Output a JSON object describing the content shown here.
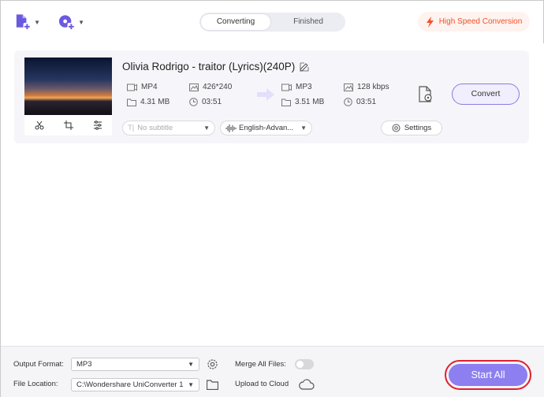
{
  "toolbar": {
    "add_file_icon": "add-file-icon",
    "add_dvd_icon": "add-dvd-icon",
    "tabs": [
      {
        "label": "Converting",
        "active": true
      },
      {
        "label": "Finished",
        "active": false
      }
    ],
    "high_speed_label": "High Speed Conversion",
    "accent": "#f0522a"
  },
  "file": {
    "title": "Olivia Rodrigo - traitor (Lyrics)(240P)",
    "source": {
      "format": "MP4",
      "resolution": "426*240",
      "size": "4.31 MB",
      "duration": "03:51"
    },
    "target": {
      "format": "MP3",
      "bitrate": "128 kbps",
      "size": "3.51 MB",
      "duration": "03:51"
    },
    "convert_label": "Convert",
    "subtitle_value": "No subtitle",
    "audio_value": "English-Advan...",
    "settings_label": "Settings"
  },
  "bottom": {
    "output_format_label": "Output Format:",
    "output_format_value": "MP3",
    "merge_label": "Merge All Files:",
    "merge_on": false,
    "file_location_label": "File Location:",
    "file_location_value": "C:\\Wondershare UniConverter 1",
    "upload_label": "Upload to Cloud",
    "start_all_label": "Start All",
    "start_color": "#8d7ff0"
  }
}
